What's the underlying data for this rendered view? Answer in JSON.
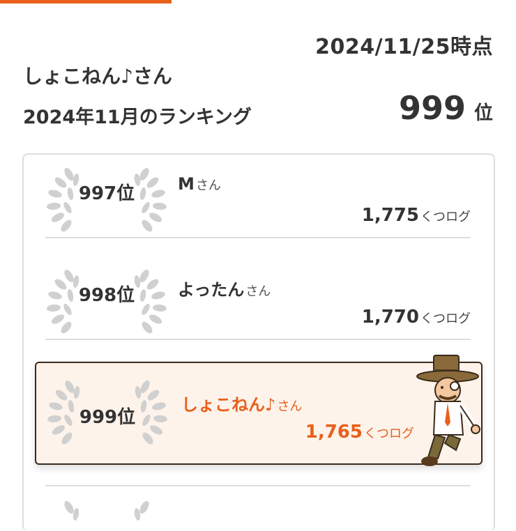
{
  "header": {
    "as_of": "2024/11/25時点",
    "username": "しょこねん♪さん",
    "month_label": "2024年11月のランキング",
    "my_rank_number": "999",
    "my_rank_unit": "位"
  },
  "ranking": {
    "rows": [
      {
        "rank": "997位",
        "name": "M",
        "suffix": "さん",
        "score": "1,775",
        "unit": "くつログ"
      },
      {
        "rank": "998位",
        "name": "よったん",
        "suffix": "さん",
        "score": "1,770",
        "unit": "くつログ"
      },
      {
        "rank": "999位",
        "name": "しょこねん♪",
        "suffix": "さん",
        "score": "1,765",
        "unit": "くつログ"
      }
    ]
  },
  "colors": {
    "accent": "#e8601c",
    "highlight_bg": "#fdf3ea",
    "wreath": "#d0d0d0"
  },
  "icons": {
    "wreath": "laurel-wreath-icon",
    "mascot": "detective-mascot-icon"
  }
}
